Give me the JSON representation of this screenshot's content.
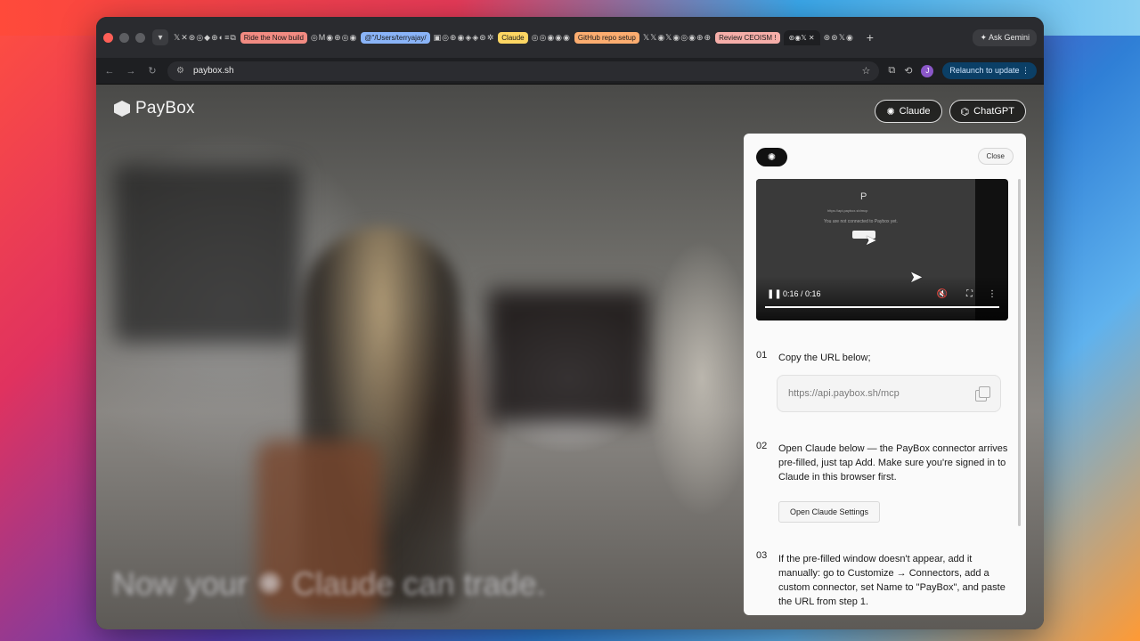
{
  "browser": {
    "tabs": {
      "groups": [
        {
          "label": "Ride the Now build",
          "color": "#f28b82"
        },
        {
          "label": "@\"/Users/terryajay/",
          "color": "#8ab4f8"
        },
        {
          "label": "Claude",
          "color": "#fdd663"
        },
        {
          "label": "GitHub repo setup",
          "color": "#fcad70"
        },
        {
          "label": "Review CEOISM !",
          "color": "#f6aea9"
        }
      ],
      "ask_gemini": "Ask Gemini",
      "new_tab": "+"
    },
    "toolbar": {
      "url": "paybox.sh",
      "relaunch": "Relaunch to update",
      "avatar_initial": "J"
    }
  },
  "site": {
    "logo": "PayBox",
    "pills": {
      "claude": "Claude",
      "chatgpt": "ChatGPT"
    },
    "hero_text": "Now your ✺ Claude can trade."
  },
  "panel": {
    "close": "Close",
    "badge_icon": "claude-burst-icon",
    "video": {
      "screen_letter": "P",
      "screen_url": "https://api.paybox.sh/mcp",
      "screen_message": "You are not connected to Paybox yet.",
      "time": "0:16 / 0:16",
      "progress": 1.0
    },
    "steps": [
      {
        "num": "01",
        "text": "Copy the URL below;"
      },
      {
        "num": "02",
        "text": "Open Claude below — the PayBox connector arrives pre-filled, just tap Add. Make sure you're signed in to Claude in this browser first."
      },
      {
        "num": "03",
        "text": "If the pre-filled window doesn't appear, add it manually: go to Customize → Connectors, add a custom connector, set Name to \"PayBox\", and paste the URL from step 1."
      }
    ],
    "url_field": "https://api.paybox.sh/mcp",
    "open_settings": "Open Claude Settings"
  }
}
